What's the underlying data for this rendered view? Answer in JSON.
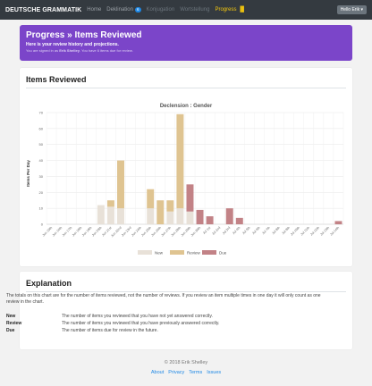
{
  "navbar": {
    "brand": "DEUTSCHE GRAMMATIK",
    "links": [
      {
        "label": "Home"
      },
      {
        "label": "Deklination",
        "badge": "6"
      },
      {
        "label": "Konjugation"
      },
      {
        "label": "Wortstellung"
      },
      {
        "label": "Progress"
      }
    ],
    "user_button": "Hello Erik"
  },
  "hero": {
    "title": "Progress » Items Reviewed",
    "subtitle": "Here is your review history and projections.",
    "note_prefix": "You are signed in as",
    "note_user": "Erik Shelley",
    "note_suffix": ". You have 6 items due for review."
  },
  "items_card": {
    "heading": "Items Reviewed"
  },
  "chart_data": {
    "type": "bar",
    "stacked": true,
    "title": "Declension : Gender",
    "ylabel": "Items Per Day",
    "xlabel": "",
    "ylim": [
      0,
      70
    ],
    "yticks": [
      0,
      10,
      20,
      30,
      40,
      50,
      60,
      70
    ],
    "grid": true,
    "legend_position": "bottom",
    "categories": [
      "Jun 15th",
      "Jun 16th",
      "Jun 17th",
      "Jun 18th",
      "Jun 19th",
      "Jun 20th",
      "Jun 21st",
      "Jun 22nd",
      "Jun 23rd",
      "Jun 24th",
      "Jun 25th",
      "Jun 26th",
      "Jun 27th",
      "Jun 28th",
      "Jun 29th",
      "Jun 30th",
      "Jul 1st",
      "Jul 2nd",
      "Jul 3rd",
      "Jul 4th",
      "Jul 5th",
      "Jul 6th",
      "Jul 7th",
      "Jul 8th",
      "Jul 9th",
      "Jul 10th",
      "Jul 11th",
      "Jul 12th",
      "Jul 13th",
      "Jul 14th"
    ],
    "series": [
      {
        "name": "New",
        "color": "#e8e1d8",
        "values": [
          0,
          0,
          0,
          0,
          0,
          12,
          11,
          10,
          0,
          0,
          10,
          0,
          8,
          10,
          8,
          0,
          0,
          0,
          0,
          0,
          0,
          0,
          0,
          0,
          0,
          0,
          0,
          0,
          0,
          0
        ]
      },
      {
        "name": "Review",
        "color": "#dfc491",
        "values": [
          0,
          0,
          0,
          0,
          0,
          0,
          4,
          30,
          0,
          0,
          12,
          15,
          7,
          59,
          0,
          0,
          0,
          0,
          0,
          0,
          0,
          0,
          0,
          0,
          0,
          0,
          0,
          0,
          0,
          0
        ]
      },
      {
        "name": "Due",
        "color": "#c28286",
        "values": [
          0,
          0,
          0,
          0,
          0,
          0,
          0,
          0,
          0,
          0,
          0,
          0,
          0,
          0,
          17,
          9,
          5,
          0,
          10,
          4,
          0,
          0,
          0,
          0,
          0,
          0,
          0,
          0,
          0,
          2
        ]
      }
    ]
  },
  "explanation": {
    "heading": "Explanation",
    "paragraph": "The totals on this chart are for the number of items reviewed, not the number of reviews. If you review an item multiple times in one day it will only count as one review in the chart.",
    "definitions": [
      {
        "term": "New",
        "text": "The number of items you reviewed that you have not yet answered correctly."
      },
      {
        "term": "Review",
        "text": "The number of items you reviewed that you have previously answered correctly."
      },
      {
        "term": "Due",
        "text": "The number of items due for review in the future."
      }
    ]
  },
  "footer": {
    "copyright": "© 2018 Erik Shelley",
    "links": [
      "About",
      "Privacy",
      "Terms",
      "Issues"
    ]
  }
}
